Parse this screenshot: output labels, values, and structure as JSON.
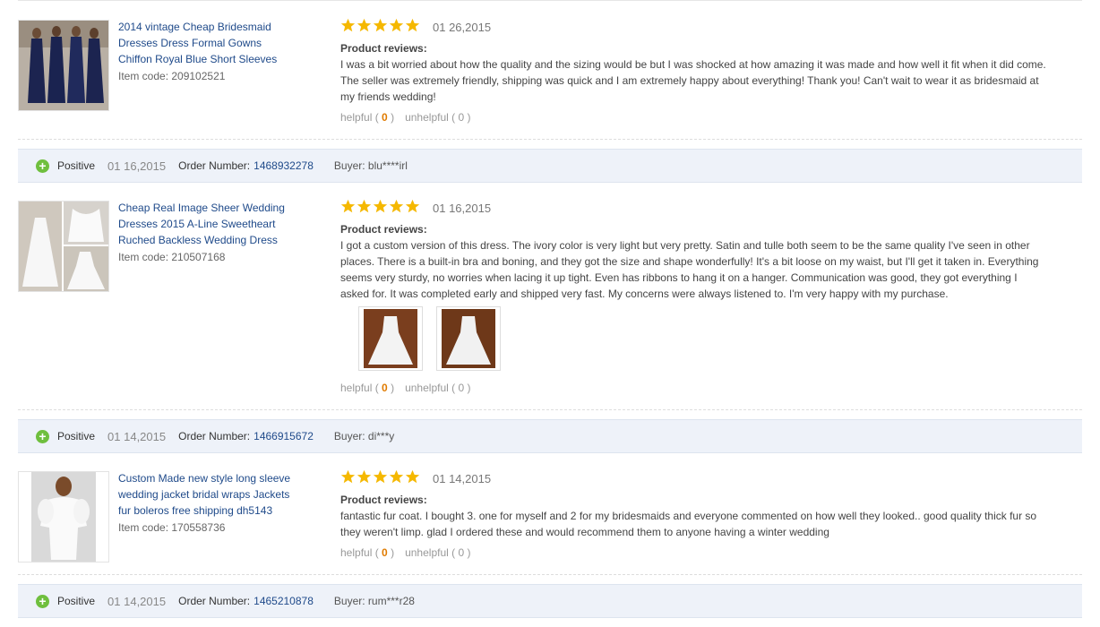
{
  "reviews": [
    {
      "product_title": "2014 vintage Cheap Bridesmaid Dresses Dress Formal Gowns Chiffon Royal Blue Short Sleeves",
      "item_code": "Item code: 209102521",
      "rating": 5,
      "date": "01 26,2015",
      "reviews_label": "Product reviews:",
      "text": "I was a bit worried about how the quality and the sizing would be but I was shocked at how amazing it was made and how well it fit when it did come. The seller was extremely friendly, shipping was quick and I am extremely happy about everything! Thank you! Can't wait to wear it as bridesmaid at my friends wedding!",
      "helpful_label": "helpful",
      "helpful_count": "0",
      "unhelpful_label": "unhelpful",
      "unhelpful_count": "0"
    },
    {
      "product_title": "Cheap Real Image Sheer Wedding Dresses 2015 A-Line Sweetheart Ruched Backless Wedding Dress",
      "item_code": "Item code: 210507168",
      "rating": 5,
      "date": "01 16,2015",
      "reviews_label": "Product reviews:",
      "text": "I got a custom version of this dress. The ivory color is very light but very pretty. Satin and tulle both seem to be the same quality I've seen in other places. There is a built-in bra and boning, and they got the size and shape wonderfully! It's a bit loose on my waist, but I'll get it taken in. Everything seems very sturdy, no worries when lacing it up tight. Even has ribbons to hang it on a hanger. Communication was good, they got everything I asked for. It was completed early and shipped very fast. My concerns were always listened to. I'm very happy with my purchase.",
      "helpful_label": "helpful",
      "helpful_count": "0",
      "unhelpful_label": "unhelpful",
      "unhelpful_count": "0"
    },
    {
      "product_title": "Custom Made new style long sleeve wedding jacket bridal wraps Jackets fur boleros free shipping dh5143",
      "item_code": "Item code: 170558736",
      "rating": 5,
      "date": "01 14,2015",
      "reviews_label": "Product reviews:",
      "text": "fantastic fur coat. I bought 3. one for myself and 2 for my bridesmaids and everyone commented on how well they looked.. good quality thick fur so they weren't limp. glad I ordered these and would recommend them to anyone having a winter wedding",
      "helpful_label": "helpful",
      "helpful_count": "0",
      "unhelpful_label": "unhelpful",
      "unhelpful_count": "0"
    }
  ],
  "bars": [
    {
      "sentiment": "Positive",
      "date": "01 16,2015",
      "order_label": "Order Number:",
      "order_number": "1468932278",
      "buyer": "Buyer: blu****irl"
    },
    {
      "sentiment": "Positive",
      "date": "01 14,2015",
      "order_label": "Order Number:",
      "order_number": "1466915672",
      "buyer": "Buyer: di***y"
    },
    {
      "sentiment": "Positive",
      "date": "01 14,2015",
      "order_label": "Order Number:",
      "order_number": "1465210878",
      "buyer": "Buyer: rum***r28"
    }
  ],
  "icons": {
    "star": "star-icon",
    "positive": "plus-circle-icon"
  },
  "colors": {
    "star": "#f5b800",
    "positive": "#6fbf3e",
    "link": "#1f4a8a",
    "count": "#e07b00",
    "bar_bg": "#eef2f9"
  }
}
